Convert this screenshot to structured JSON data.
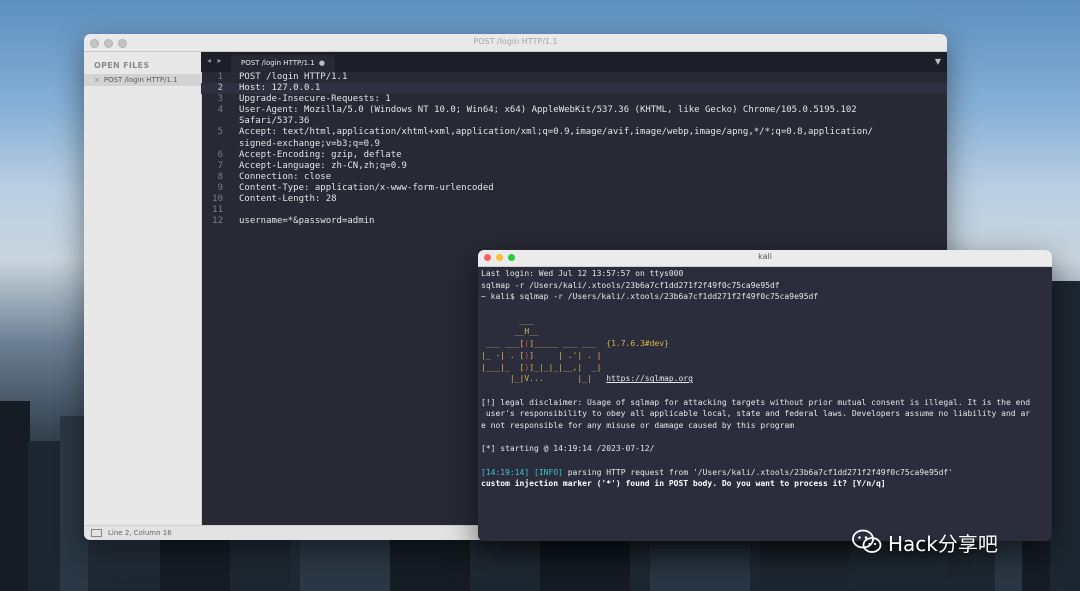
{
  "editor": {
    "window_title": "POST /login HTTP/1.1",
    "sidebar_header": "OPEN FILES",
    "open_file": "POST /login HTTP/1.1",
    "tab_nav": "◂ ▸",
    "tab_label": "POST /login HTTP/1.1",
    "tab_close": "●",
    "tab_menu": "▼",
    "current_line": 2,
    "lines": [
      {
        "n": "1",
        "t": "POST /login HTTP/1.1"
      },
      {
        "n": "2",
        "t": "Host: 127.0.0.1"
      },
      {
        "n": "3",
        "t": "Upgrade-Insecure-Requests: 1"
      },
      {
        "n": "4",
        "t": "User-Agent: Mozilla/5.0 (Windows NT 10.0; Win64; x64) AppleWebKit/537.36 (KHTML, like Gecko) Chrome/105.0.5195.102"
      },
      {
        "n": "",
        "t": "Safari/537.36"
      },
      {
        "n": "5",
        "t": "Accept: text/html,application/xhtml+xml,application/xml;q=0.9,image/avif,image/webp,image/apng,*/*;q=0.8,application/"
      },
      {
        "n": "",
        "t": "signed-exchange;v=b3;q=0.9"
      },
      {
        "n": "6",
        "t": "Accept-Encoding: gzip, deflate"
      },
      {
        "n": "7",
        "t": "Accept-Language: zh-CN,zh;q=0.9"
      },
      {
        "n": "8",
        "t": "Connection: close"
      },
      {
        "n": "9",
        "t": "Content-Type: application/x-www-form-urlencoded"
      },
      {
        "n": "10",
        "t": "Content-Length: 28"
      },
      {
        "n": "11",
        "t": ""
      },
      {
        "n": "12",
        "t": "username=*&password=admin"
      }
    ],
    "status": "Line 2, Column 16"
  },
  "terminal": {
    "title": "kali",
    "last_login": "Last login: Wed Jul 12 13:57:57 on ttys000",
    "cmd1": "sqlmap -r /Users/kali/.xtools/23b6a7cf1dd271f2f49f0c75ca9e95df",
    "prompt": "~ kali$ sqlmap -r /Users/kali/.xtools/23b6a7cf1dd271f2f49f0c75ca9e95df",
    "version": "{1.7.6.3#dev}",
    "url": "https://sqlmap.org",
    "disclaimer1": "[!] legal disclaimer: Usage of sqlmap for attacking targets without prior mutual consent is illegal. It is the end",
    "disclaimer2": " user's responsibility to obey all applicable local, state and federal laws. Developers assume no liability and ar",
    "disclaimer3": "e not responsible for any misuse or damage caused by this program",
    "starting": "[*] starting @ 14:19:14 /2023-07-12/",
    "info_time": "[14:19:14]",
    "info_tag": "[INFO]",
    "info_msg": " parsing HTTP request from '/Users/kali/.xtools/23b6a7cf1dd271f2f49f0c75ca9e95df'",
    "question": "custom injection marker ('*') found in POST body. Do you want to process it? [Y/n/q]"
  },
  "watermark": {
    "text": "Hack分享吧"
  },
  "colors": {
    "terminal_bg": "#2b2d3c",
    "editor_bg": "#272935",
    "logo_yellow": "#d4b84a",
    "logo_red": "#e14a4a",
    "info_cyan": "#3fc1c9"
  }
}
